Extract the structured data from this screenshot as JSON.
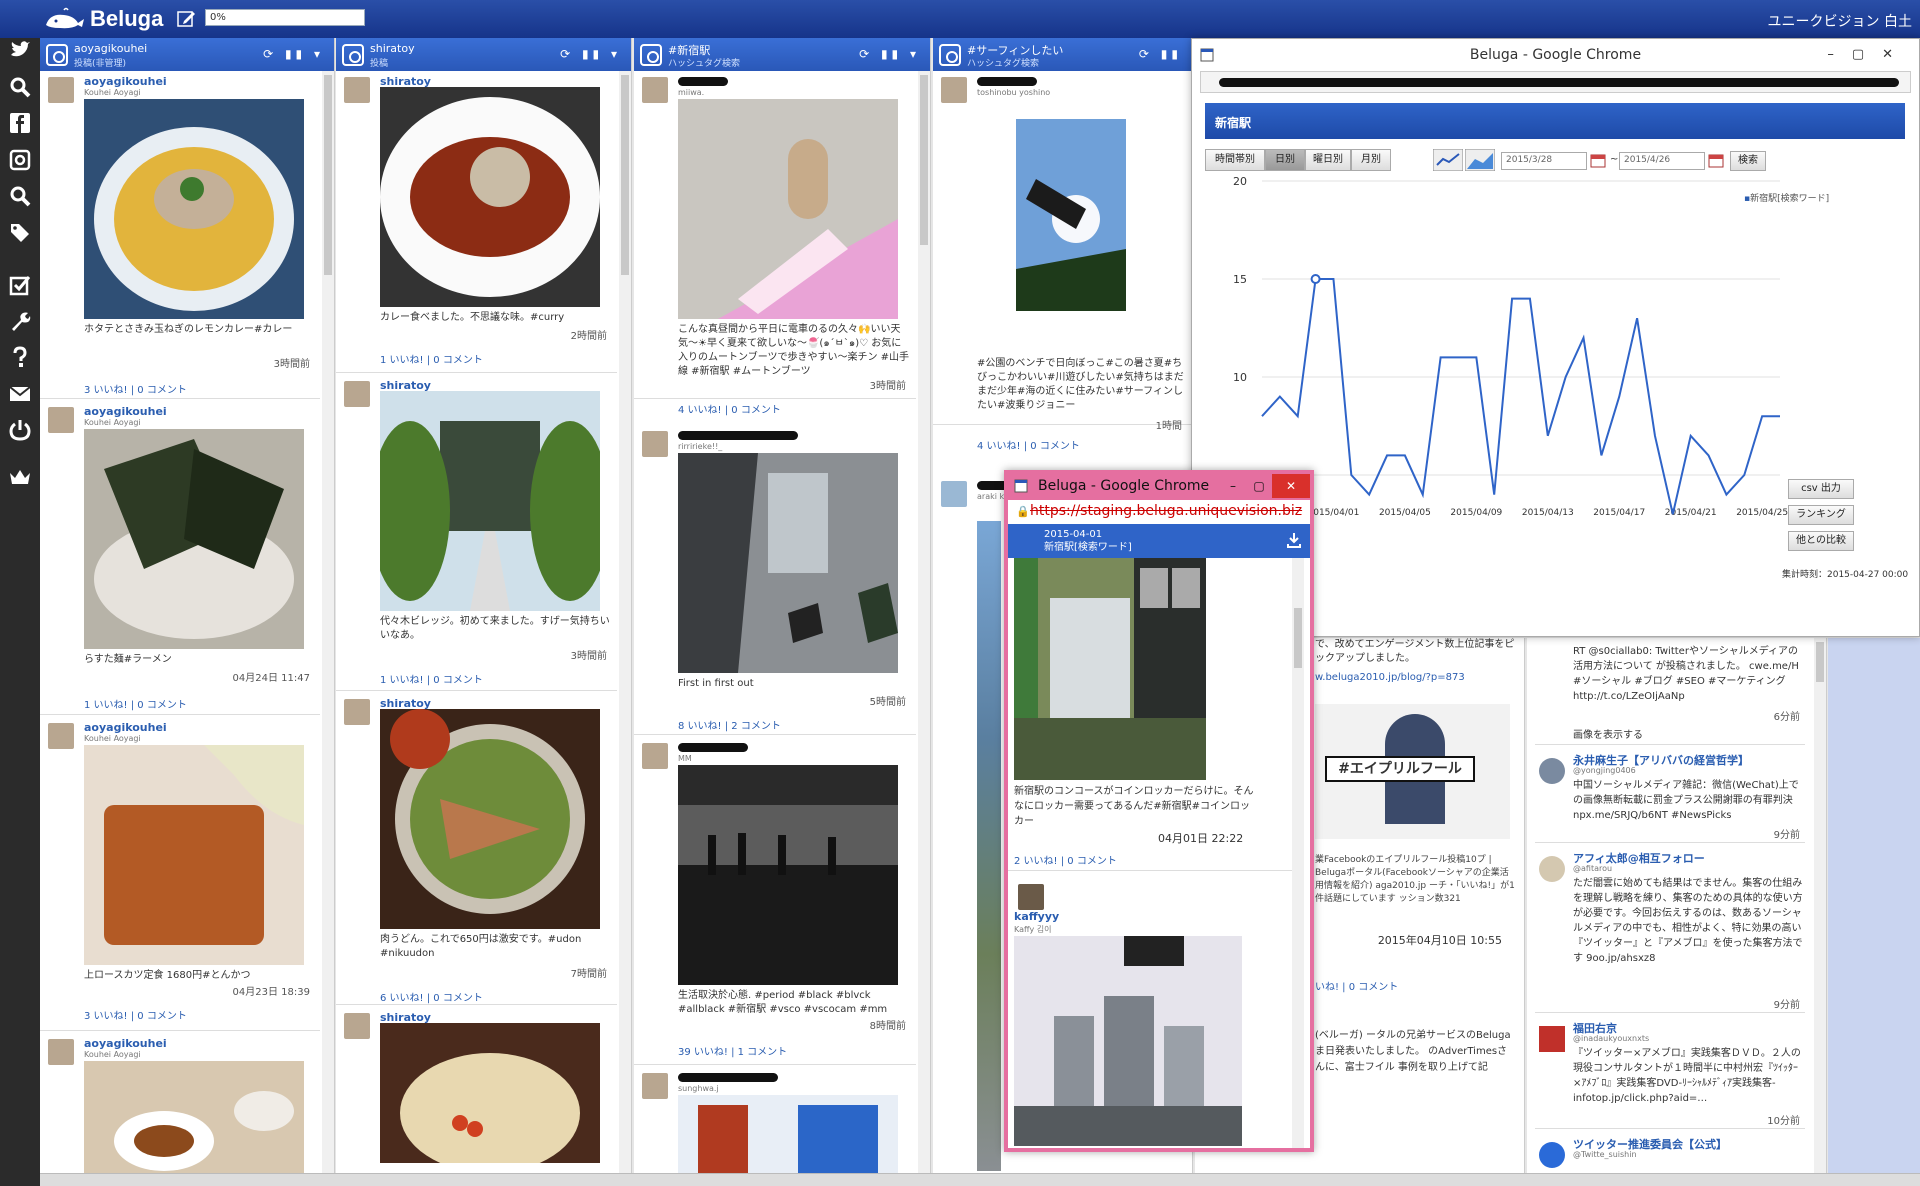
{
  "app": {
    "name": "Beluga",
    "progress_text": "0%",
    "company": "ユニークビジョン 白土"
  },
  "columns": [
    {
      "title": "aoyagikouhei",
      "subtitle": "投稿(非管理)",
      "posts": [
        {
          "user": "aoyagikouhei",
          "sub": "Kouhei Aoyagi",
          "caption": "ホタテとさきみ玉ねぎのレモンカレー#カレー",
          "time": "3時間前",
          "likes": "3 いいね! | 0 コメント"
        },
        {
          "user": "aoyagikouhei",
          "sub": "Kouhei Aoyagi",
          "caption": "らすた麺#ラーメン",
          "time": "04月24日 11:47",
          "likes": "1 いいね! | 0 コメント"
        },
        {
          "user": "aoyagikouhei",
          "sub": "Kouhei Aoyagi",
          "caption": "上ロースカツ定食 1680円#とんかつ",
          "time": "04月23日 18:39",
          "likes": "3 いいね! | 0 コメント"
        },
        {
          "user": "aoyagikouhei",
          "sub": "Kouhei Aoyagi",
          "caption": "",
          "time": "",
          "likes": ""
        }
      ]
    },
    {
      "title": "shiratoy",
      "subtitle": "投稿",
      "posts": [
        {
          "user": "shiratoy",
          "sub": "",
          "caption": "カレー食べました。不思議な味。#curry",
          "time": "2時間前",
          "likes": "1 いいね! | 0 コメント"
        },
        {
          "user": "shiratoy",
          "sub": "",
          "caption": "代々木ビレッジ。初めて来ました。すげー気持ちいいなあ。",
          "time": "3時間前",
          "likes": "1 いいね! | 0 コメント"
        },
        {
          "user": "shiratoy",
          "sub": "",
          "caption": "肉うどん。これで650円は激安です。#udon #nikuudon",
          "time": "7時間前",
          "likes": "6 いいね! | 0 コメント"
        },
        {
          "user": "shiratoy",
          "sub": "",
          "caption": "",
          "time": "",
          "likes": ""
        }
      ]
    },
    {
      "title": "#新宿駅",
      "subtitle": "ハッシュタグ検索",
      "posts": [
        {
          "user": "",
          "sub": "miiwa.",
          "caption": "こんな真昼間から平日に電車のるの久々🙌いい天気〜☀早く夏来て欲しいな〜🍧(๑´ㅂ`๑)♡ お気に入りのムートンブーツで歩きやすい〜楽チン #山手線 #新宿駅 #ムートンブーツ",
          "time": "3時間前",
          "likes": "4 いいね! | 0 コメント"
        },
        {
          "user": "",
          "sub": "rirririeke!!_",
          "caption": "First in first out",
          "time": "5時間前",
          "likes": "8 いいね! | 2 コメント"
        },
        {
          "user": "",
          "sub": "MM",
          "caption": "生活取決於心態. #period #black #blvck #allblack #新宿駅 #vsco #vscocam #mm",
          "time": "8時間前",
          "likes": "39 いいね! | 1 コメント"
        },
        {
          "user": "",
          "sub": "sunghwa.j",
          "caption": "",
          "time": "",
          "likes": ""
        }
      ]
    },
    {
      "title": "#サーフィンしたい",
      "subtitle": "ハッシュタグ検索",
      "posts": [
        {
          "user": "",
          "sub": "toshinobu yoshino",
          "caption": "#公園のベンチで日向ぼっこ#この暑さ夏#ちびっこかわいい#川遊びしたい#気持ちはまだまだ少年#海の近くに住みたい#サーフィンしたい#波乗りジョニー",
          "time": "1時間",
          "likes": "4 いいね! | 0 コメント"
        },
        {
          "user": "",
          "sub": "araki kana",
          "caption": "",
          "time": "",
          "likes": ""
        }
      ]
    }
  ],
  "chromeA": {
    "title": "Beluga - Google Chrome",
    "keyword": "新宿駅",
    "tabs": [
      "時間帯別",
      "日別",
      "曜日別",
      "月別"
    ],
    "date_from": "2015/3/28",
    "date_to": "2015/4/26",
    "search_label": "検索",
    "legend": "新宿駅[検索ワード]",
    "csv_label": "csv 出力",
    "ranking_label": "ランキング",
    "compare_label": "他との比較",
    "agg_time": "集計時刻：2015-04-27 00:00"
  },
  "chart_data": {
    "type": "line",
    "title": "",
    "xlabel": "",
    "ylabel": "",
    "ylim": [
      5,
      20
    ],
    "yticks": [
      20,
      15,
      10
    ],
    "xticks": [
      "2015/04/01",
      "2015/04/05",
      "2015/04/09",
      "2015/04/13",
      "2015/04/17",
      "2015/04/21",
      "2015/04/25"
    ],
    "series": [
      {
        "name": "新宿駅[検索ワード]",
        "x": [
          "2015/03/28",
          "2015/03/29",
          "2015/03/30",
          "2015/03/31",
          "2015/04/01",
          "2015/04/02",
          "2015/04/03",
          "2015/04/04",
          "2015/04/05",
          "2015/04/06",
          "2015/04/07",
          "2015/04/08",
          "2015/04/09",
          "2015/04/10",
          "2015/04/11",
          "2015/04/12",
          "2015/04/13",
          "2015/04/14",
          "2015/04/15",
          "2015/04/16",
          "2015/04/17",
          "2015/04/18",
          "2015/04/19",
          "2015/04/20",
          "2015/04/21",
          "2015/04/22",
          "2015/04/23",
          "2015/04/24",
          "2015/04/25",
          "2015/04/26"
        ],
        "values": [
          8,
          9,
          8,
          15,
          15,
          5,
          4,
          6,
          6,
          4,
          11,
          11,
          11,
          4,
          14,
          14,
          7,
          10,
          12,
          6,
          9,
          13,
          7,
          3,
          7,
          6,
          4,
          5,
          8,
          8
        ]
      }
    ]
  },
  "chromeB": {
    "title": "Beluga - Google Chrome",
    "url": "https://staging.beluga.uniquevision.biz",
    "date": "2015-04-01",
    "keyword": "新宿駅[検索ワード]",
    "caption": "新宿駅のコンコースがコインロッカーだらけに。そんなにロッカー需要ってあるんだ#新宿駅#コインロッカー",
    "time": "04月01日 22:22",
    "likes": "2 いいね! | 0 コメント",
    "user2": "kaffyyy",
    "user2_sub": "Kaffy 김이"
  },
  "col5": {
    "posts": [
      {
        "text": "で、改めてエンゲージメント数上位記事をピックアップしました。",
        "link": "w.beluga2010.jp/blog/?p=873"
      },
      {
        "image_text": "#エイプリルフール",
        "text": "業Facebookのエイプリルフール投稿10プ | Belugaポータル(Facebookソーシャアの企業活用情報を紹介) aga2010.jp ーチ・「いいね!」が1件話題にしています ッション数321",
        "time": "2015年04月10日 10:55",
        "likes": "いね! | 0 コメント"
      },
      {
        "text": "(ベルーガ) ータルの兄弟サービスのBeluga ま日発表いたしました。 のAdverTimesさんに、富士フイル 事例を取り上げて記"
      }
    ]
  },
  "col6": {
    "tweets": [
      {
        "user": "",
        "handle": "",
        "text": "RT @s0ciallab0: Twitterやソーシャルメディアの活用方法について が投稿されました。 cwe.me/H #ソーシャル #ブログ #SEO #マーケティング http://t.co/LZeOIjAaNp",
        "time": "6分前",
        "action": "画像を表示する"
      },
      {
        "user": "永井麻生子【アリババの経営哲学】",
        "handle": "@yongjing0406",
        "text": "中国ソーシャルメディア雑記：微信(WeChat)上での画像無断転載に罰金プラス公開謝罪の有罪判決 npx.me/SRJQ/b6NT #NewsPicks",
        "time": "9分前"
      },
      {
        "user": "アフィ太郎@相互フォロー",
        "handle": "@afitarou",
        "text": "ただ闇雲に始めても結果はでません。集客の仕組みを理解し戦略を練り、集客のための具体的な使い方が必要です。今回お伝えするのは、数あるソーシャルメディアの中でも、相性がよく、特に効果の高い『ツイッター』と『アメブロ』を使った集客方法です 9oo.jp/ahsxz8",
        "time": "9分前"
      },
      {
        "user": "福田右京",
        "handle": "@inadaukyouxnxts",
        "text": "『ツイッター×アメブロ』実践集客ＤＶＤ。２人の現役コンサルタントが１時間半に中村州宏『ﾂｲｯﾀｰ×ｱﾒﾌﾞﾛ』実践集客DVD-ﾘｰｼｬﾙﾒﾃﾞｨｱ実践集客- infotop.jp/click.php?aid=…",
        "time": "10分前"
      },
      {
        "user": "ツイッター推進委員会【公式】",
        "handle": "@Twitte_suishin",
        "text": "",
        "time": ""
      }
    ]
  }
}
